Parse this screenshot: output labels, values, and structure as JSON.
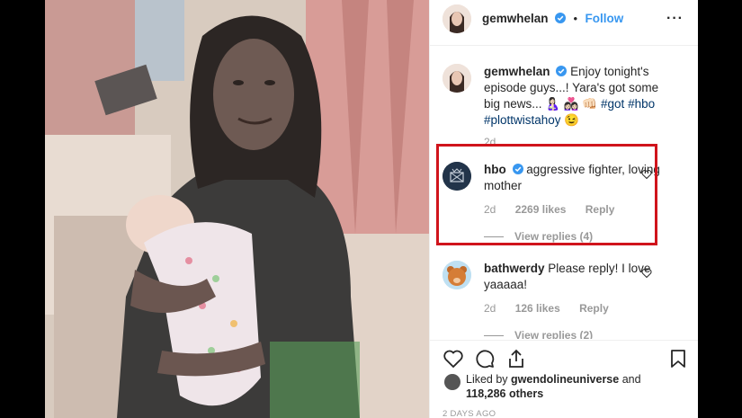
{
  "post": {
    "username": "gemwhelan",
    "follow_label": "Follow",
    "more_icon": "more-horizontal-icon",
    "verified_icon": "verified-badge-icon",
    "caption": {
      "username": "gemwhelan",
      "text": "Enjoy tonight's episode guys...! Yara's got some big news...",
      "emoji": "🤱🏻 👩🏻‍❤️‍👩🏻 👊🏻",
      "hashtags": [
        "#got",
        "#hbo",
        "#plottwistahoy"
      ],
      "end_emoji": "😉",
      "time": "2d"
    },
    "comments": [
      {
        "username": "hbo",
        "text": "aggressive fighter, loving mother",
        "time": "2d",
        "likes": "2269 likes",
        "reply_label": "Reply",
        "view_replies": "View replies (4)"
      },
      {
        "username": "bathwerdy",
        "text": "Please reply! I love yaaaaa!",
        "time": "2d",
        "likes": "126 likes",
        "reply_label": "Reply",
        "view_replies": "View replies (2)"
      }
    ],
    "liked_by": {
      "prefix": "Liked by",
      "user": "gwendolineuniverse",
      "joiner": "and",
      "count": "118,286 others"
    },
    "posted": "2 DAYS AGO"
  },
  "colors": {
    "link_blue": "#3897f0",
    "hashtag_blue": "#003569",
    "highlight_red": "#d0141c",
    "meta_gray": "#999999"
  }
}
